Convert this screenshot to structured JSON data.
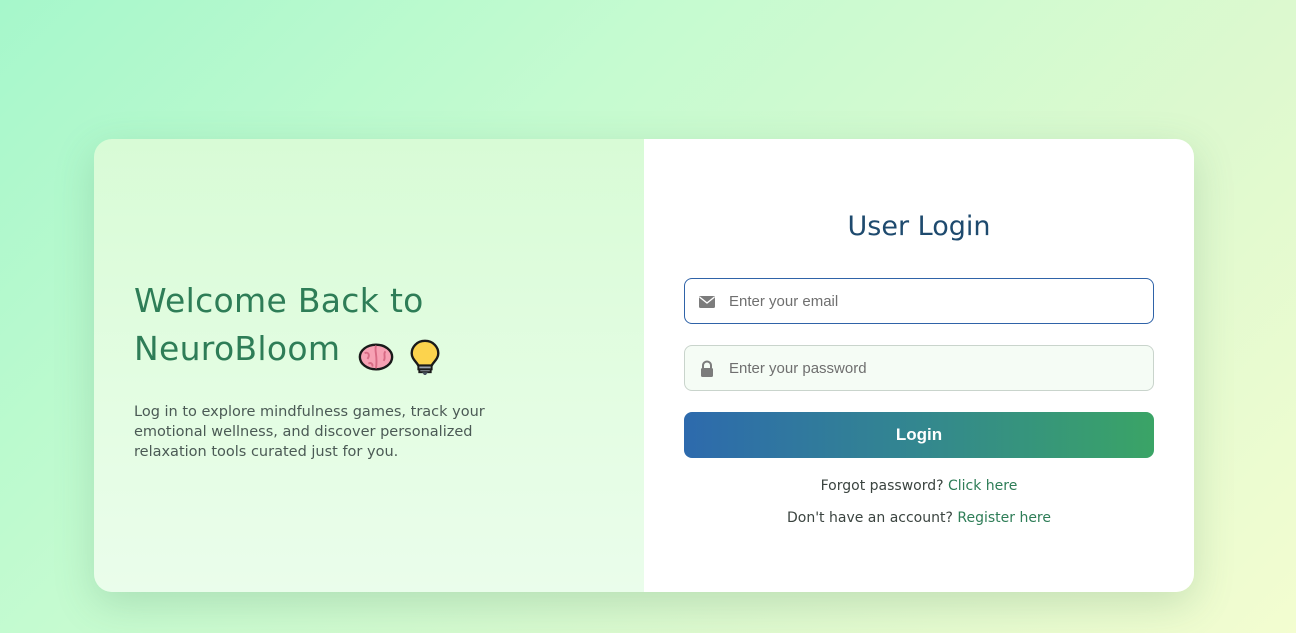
{
  "welcome": {
    "line1": "Welcome Back to",
    "line2": "NeuroBloom",
    "emoji_icons": [
      "brain-icon",
      "lightbulb-icon"
    ],
    "description": "Log in to explore mindfulness games, track your emotional wellness, and discover personalized relaxation tools curated just for you."
  },
  "login": {
    "title": "User Login",
    "email": {
      "placeholder": "Enter your email",
      "value": "",
      "icon": "envelope-icon"
    },
    "password": {
      "placeholder": "Enter your password",
      "value": "",
      "icon": "lock-icon"
    },
    "button_label": "Login",
    "forgot_text": "Forgot password?",
    "forgot_link": "Click here",
    "register_text": "Don't have an account?",
    "register_link": "Register here"
  },
  "colors": {
    "accent_green": "#2e7d57",
    "title_blue": "#1e4a6e",
    "button_gradient_start": "#2d6aad",
    "button_gradient_end": "#3aa466",
    "email_focus_border": "#2f63a8"
  }
}
